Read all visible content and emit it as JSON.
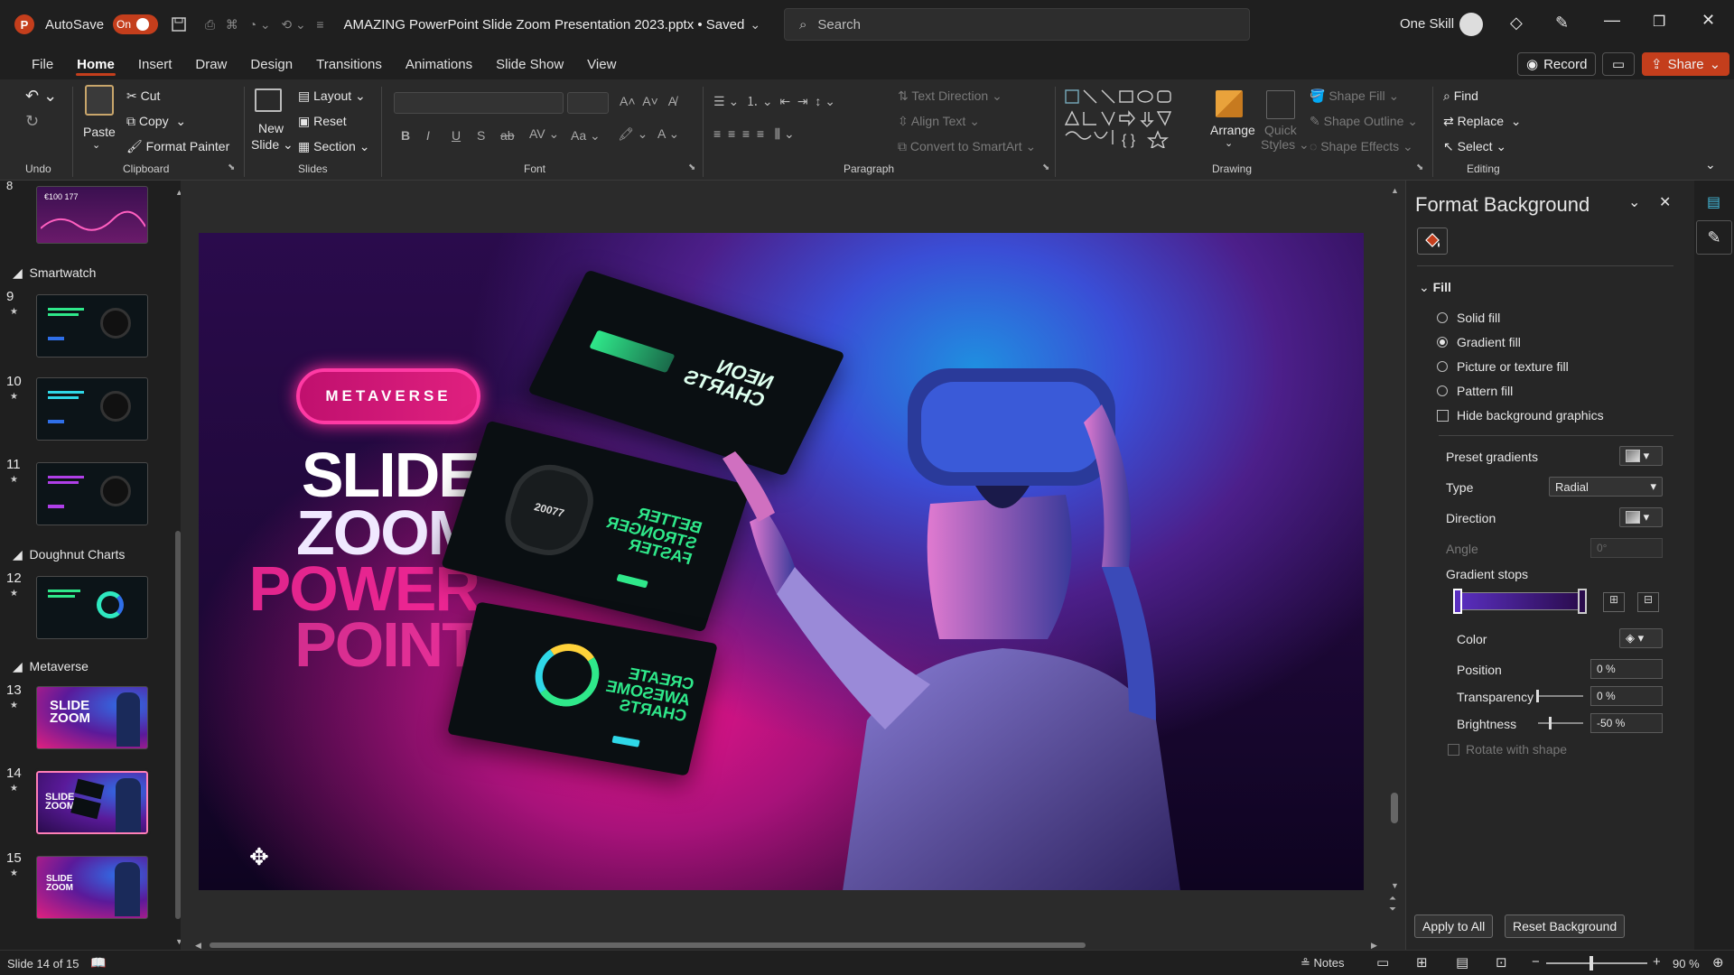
{
  "titlebar": {
    "app_letter": "P",
    "autosave_label": "AutoSave",
    "autosave_state": "On",
    "document_title": "AMAZING PowerPoint Slide Zoom Presentation 2023.pptx • Saved",
    "search_placeholder": "Search",
    "user_name": "One Skill"
  },
  "menu": {
    "tabs": [
      "File",
      "Home",
      "Insert",
      "Draw",
      "Design",
      "Transitions",
      "Animations",
      "Slide Show",
      "View"
    ],
    "active_tab": "Home",
    "record_label": "Record",
    "share_label": "Share"
  },
  "ribbon": {
    "undo_group": "Undo",
    "clipboard": {
      "label": "Clipboard",
      "paste": "Paste",
      "cut": "Cut",
      "copy": "Copy",
      "format_painter": "Format Painter"
    },
    "slides": {
      "label": "Slides",
      "new_slide_line1": "New",
      "new_slide_line2": "Slide",
      "layout": "Layout",
      "reset": "Reset",
      "section": "Section"
    },
    "font": {
      "label": "Font",
      "bold": "B",
      "italic": "I",
      "underline": "U",
      "strike": "S",
      "case": "Aa"
    },
    "paragraph": {
      "label": "Paragraph",
      "text_direction": "Text Direction",
      "align_text": "Align Text",
      "convert_smartart": "Convert to SmartArt"
    },
    "drawing": {
      "label": "Drawing",
      "arrange": "Arrange",
      "quick_styles_1": "Quick",
      "quick_styles_2": "Styles",
      "shape_fill": "Shape Fill",
      "shape_outline": "Shape Outline",
      "shape_effects": "Shape Effects"
    },
    "editing": {
      "label": "Editing",
      "find": "Find",
      "replace": "Replace",
      "select": "Select"
    }
  },
  "thumbnails": {
    "sections": [
      "Smartwatch",
      "Doughnut Charts",
      "Metaverse"
    ],
    "slide_numbers": [
      "8",
      "9",
      "10",
      "11",
      "12",
      "13",
      "14",
      "15"
    ],
    "thumb8_text": "€100 177",
    "selected_slide": "14"
  },
  "slide": {
    "pill": "METAVERSE",
    "line1": "SLIDE",
    "line2": "ZOOM",
    "line3": "POWER",
    "line4": "POINT",
    "card1_text": "NEON\nCHARTS",
    "card2_text": "BETTER\nSTRONGER\nFASTER",
    "card2_watch": "20077",
    "card3_text": "CREATE\nAWESOME\nCHARTS"
  },
  "pane": {
    "title": "Format Background",
    "fill_header": "Fill",
    "options": [
      "Solid fill",
      "Gradient fill",
      "Picture or texture fill",
      "Pattern fill"
    ],
    "selected_option": "Gradient fill",
    "hide_graphics": "Hide background graphics",
    "preset_gradients": "Preset gradients",
    "type_label": "Type",
    "type_value": "Radial",
    "direction": "Direction",
    "angle_label": "Angle",
    "angle_value": "0°",
    "gradient_stops": "Gradient stops",
    "color": "Color",
    "position_label": "Position",
    "position_value": "0 %",
    "transparency_label": "Transparency",
    "transparency_value": "0 %",
    "brightness_label": "Brightness",
    "brightness_value": "-50 %",
    "rotate_with_shape": "Rotate with shape",
    "apply_all": "Apply to All",
    "reset_background": "Reset Background",
    "gradient_colors": [
      "#5a2fc0",
      "#2a0b4c"
    ]
  },
  "status": {
    "slide_info": "Slide 14 of 15",
    "notes": "Notes",
    "zoom": "90 %"
  },
  "colors": {
    "accent": "#c43e1c",
    "pink": "#ff2a9a"
  }
}
